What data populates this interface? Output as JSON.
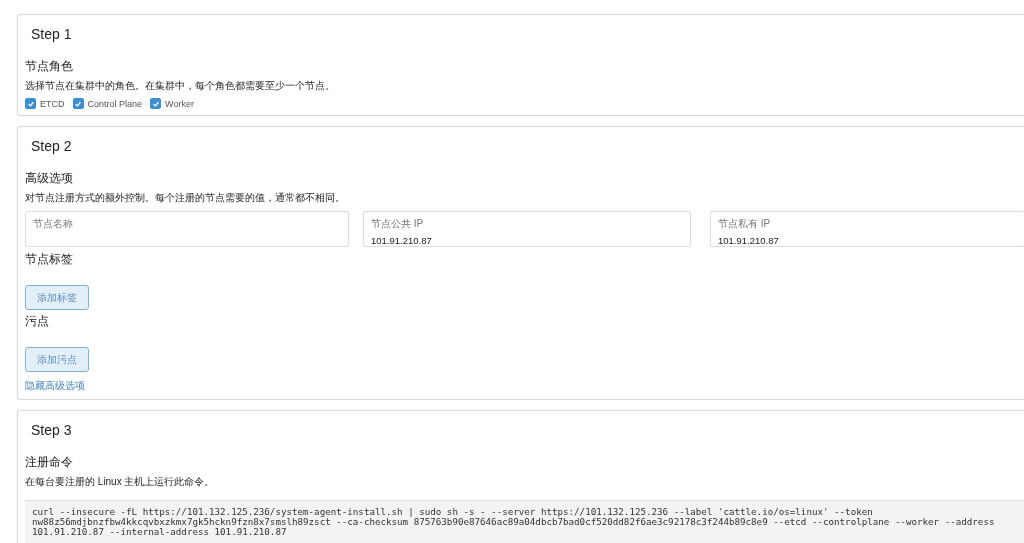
{
  "steps": [
    {
      "title": "Step 1",
      "sections": [
        {
          "kind": "roles",
          "heading": "节点角色",
          "description": "选择节点在集群中的角色。在集群中，每个角色都需要至少一个节点。",
          "roles": [
            {
              "label": "ETCD",
              "checked": true
            },
            {
              "label": "Control Plane",
              "checked": true
            },
            {
              "label": "Worker",
              "checked": true
            }
          ]
        }
      ]
    },
    {
      "title": "Step 2",
      "sections": [
        {
          "kind": "fields",
          "heading": "高级选项",
          "description": "对节点注册方式的额外控制。每个注册的节点需要的值，通常都不相同。",
          "fields": [
            {
              "label": "节点名称"
            },
            {
              "label": "节点公共 IP",
              "value": "101.91.210.87"
            },
            {
              "label": "节点私有 IP",
              "value": "101.91.210.87"
            }
          ]
        },
        {
          "kind": "button",
          "heading": "节点标签",
          "button": "添加标签"
        },
        {
          "kind": "button",
          "heading": "污点",
          "button": "添加污点"
        },
        {
          "kind": "link",
          "link": "隐藏高级选项"
        }
      ]
    },
    {
      "title": "Step 3",
      "sections": [
        {
          "kind": "code",
          "heading": "注册命令",
          "description": "在每台要注册的 Linux 主机上运行此命令。",
          "code_lines": [
            "curl --insecure -fL https://101.132.125.236/system-agent-install.sh | sudo sh -s - --server https://101.132.125.236 --label 'cattle.io/os=linux' --token",
            "nw88z56mdjbnzfbw4kkcqvbxzkmx7gk5hckn9fzn8x7smslh89zsct --ca-checksum 875763b90e87646ac89a04dbcb7bad0cf520dd82f6ae3c92178c3f244b89c8e9 --etcd --controlplane --worker --address",
            "101.91.210.87 --internal-address 101.91.210.87"
          ]
        }
      ]
    }
  ]
}
